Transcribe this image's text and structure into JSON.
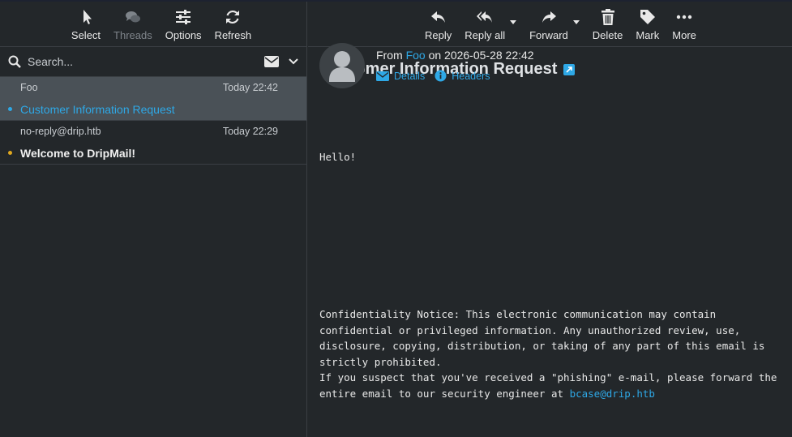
{
  "list_toolbar": {
    "select": "Select",
    "threads": "Threads",
    "options": "Options",
    "refresh": "Refresh"
  },
  "search": {
    "placeholder": "Search..."
  },
  "messages": [
    {
      "from": "Foo",
      "date": "Today 22:42",
      "subject": "Customer Information Request",
      "dot_color": "#2ea8e6"
    },
    {
      "from": "no-reply@drip.htb",
      "date": "Today 22:29",
      "subject": "Welcome to DripMail!",
      "dot_color": "#e0a81f"
    }
  ],
  "message_toolbar": {
    "reply": "Reply",
    "reply_all": "Reply all",
    "forward": "Forward",
    "delete": "Delete",
    "mark": "Mark",
    "more": "More"
  },
  "message": {
    "subject": "Customer Information Request",
    "from_prefix": "From",
    "from_name": "Foo",
    "on_text": "on 2026-05-28 22:42",
    "details_label": "Details",
    "headers_label": "Headers",
    "body": "Hello!",
    "notice_line1": "Confidentiality Notice: This electronic communication may contain confidential or privileged information. Any unauthorized review, use, disclosure, copying, distribution, or taking of any part of this email is strictly prohibited.",
    "notice_line2_prefix": "If you suspect that you've received a \"phishing\" e-mail, please forward the entire email to our security engineer at ",
    "notice_email": "bcase@drip.htb"
  },
  "colors": {
    "accent": "#2ea8e6",
    "unread_dot": "#e0a81f",
    "background": "#23272a",
    "selected_row": "#4a5157"
  }
}
